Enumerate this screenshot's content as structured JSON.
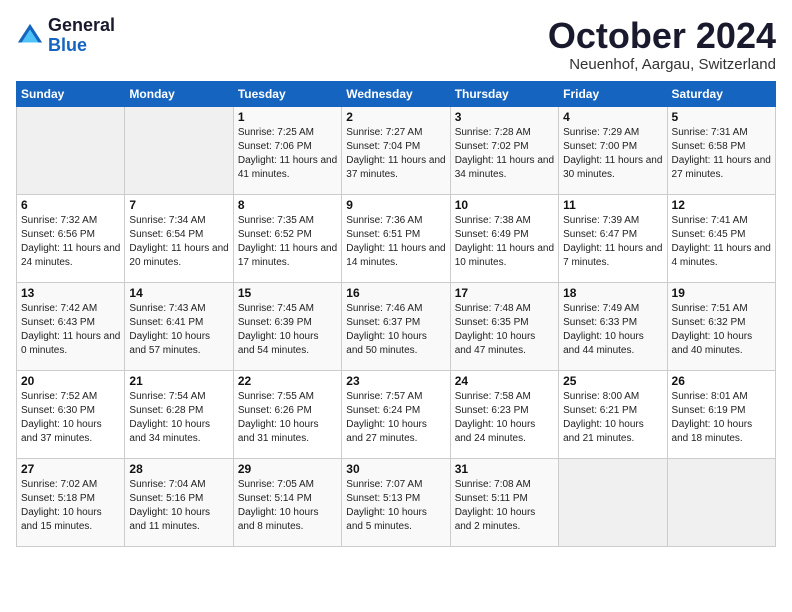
{
  "header": {
    "logo_general": "General",
    "logo_blue": "Blue",
    "month_title": "October 2024",
    "location": "Neuenhof, Aargau, Switzerland"
  },
  "days_of_week": [
    "Sunday",
    "Monday",
    "Tuesday",
    "Wednesday",
    "Thursday",
    "Friday",
    "Saturday"
  ],
  "weeks": [
    [
      {
        "day": "",
        "sunrise": "",
        "sunset": "",
        "daylight": ""
      },
      {
        "day": "",
        "sunrise": "",
        "sunset": "",
        "daylight": ""
      },
      {
        "day": "1",
        "sunrise": "Sunrise: 7:25 AM",
        "sunset": "Sunset: 7:06 PM",
        "daylight": "Daylight: 11 hours and 41 minutes."
      },
      {
        "day": "2",
        "sunrise": "Sunrise: 7:27 AM",
        "sunset": "Sunset: 7:04 PM",
        "daylight": "Daylight: 11 hours and 37 minutes."
      },
      {
        "day": "3",
        "sunrise": "Sunrise: 7:28 AM",
        "sunset": "Sunset: 7:02 PM",
        "daylight": "Daylight: 11 hours and 34 minutes."
      },
      {
        "day": "4",
        "sunrise": "Sunrise: 7:29 AM",
        "sunset": "Sunset: 7:00 PM",
        "daylight": "Daylight: 11 hours and 30 minutes."
      },
      {
        "day": "5",
        "sunrise": "Sunrise: 7:31 AM",
        "sunset": "Sunset: 6:58 PM",
        "daylight": "Daylight: 11 hours and 27 minutes."
      }
    ],
    [
      {
        "day": "6",
        "sunrise": "Sunrise: 7:32 AM",
        "sunset": "Sunset: 6:56 PM",
        "daylight": "Daylight: 11 hours and 24 minutes."
      },
      {
        "day": "7",
        "sunrise": "Sunrise: 7:34 AM",
        "sunset": "Sunset: 6:54 PM",
        "daylight": "Daylight: 11 hours and 20 minutes."
      },
      {
        "day": "8",
        "sunrise": "Sunrise: 7:35 AM",
        "sunset": "Sunset: 6:52 PM",
        "daylight": "Daylight: 11 hours and 17 minutes."
      },
      {
        "day": "9",
        "sunrise": "Sunrise: 7:36 AM",
        "sunset": "Sunset: 6:51 PM",
        "daylight": "Daylight: 11 hours and 14 minutes."
      },
      {
        "day": "10",
        "sunrise": "Sunrise: 7:38 AM",
        "sunset": "Sunset: 6:49 PM",
        "daylight": "Daylight: 11 hours and 10 minutes."
      },
      {
        "day": "11",
        "sunrise": "Sunrise: 7:39 AM",
        "sunset": "Sunset: 6:47 PM",
        "daylight": "Daylight: 11 hours and 7 minutes."
      },
      {
        "day": "12",
        "sunrise": "Sunrise: 7:41 AM",
        "sunset": "Sunset: 6:45 PM",
        "daylight": "Daylight: 11 hours and 4 minutes."
      }
    ],
    [
      {
        "day": "13",
        "sunrise": "Sunrise: 7:42 AM",
        "sunset": "Sunset: 6:43 PM",
        "daylight": "Daylight: 11 hours and 0 minutes."
      },
      {
        "day": "14",
        "sunrise": "Sunrise: 7:43 AM",
        "sunset": "Sunset: 6:41 PM",
        "daylight": "Daylight: 10 hours and 57 minutes."
      },
      {
        "day": "15",
        "sunrise": "Sunrise: 7:45 AM",
        "sunset": "Sunset: 6:39 PM",
        "daylight": "Daylight: 10 hours and 54 minutes."
      },
      {
        "day": "16",
        "sunrise": "Sunrise: 7:46 AM",
        "sunset": "Sunset: 6:37 PM",
        "daylight": "Daylight: 10 hours and 50 minutes."
      },
      {
        "day": "17",
        "sunrise": "Sunrise: 7:48 AM",
        "sunset": "Sunset: 6:35 PM",
        "daylight": "Daylight: 10 hours and 47 minutes."
      },
      {
        "day": "18",
        "sunrise": "Sunrise: 7:49 AM",
        "sunset": "Sunset: 6:33 PM",
        "daylight": "Daylight: 10 hours and 44 minutes."
      },
      {
        "day": "19",
        "sunrise": "Sunrise: 7:51 AM",
        "sunset": "Sunset: 6:32 PM",
        "daylight": "Daylight: 10 hours and 40 minutes."
      }
    ],
    [
      {
        "day": "20",
        "sunrise": "Sunrise: 7:52 AM",
        "sunset": "Sunset: 6:30 PM",
        "daylight": "Daylight: 10 hours and 37 minutes."
      },
      {
        "day": "21",
        "sunrise": "Sunrise: 7:54 AM",
        "sunset": "Sunset: 6:28 PM",
        "daylight": "Daylight: 10 hours and 34 minutes."
      },
      {
        "day": "22",
        "sunrise": "Sunrise: 7:55 AM",
        "sunset": "Sunset: 6:26 PM",
        "daylight": "Daylight: 10 hours and 31 minutes."
      },
      {
        "day": "23",
        "sunrise": "Sunrise: 7:57 AM",
        "sunset": "Sunset: 6:24 PM",
        "daylight": "Daylight: 10 hours and 27 minutes."
      },
      {
        "day": "24",
        "sunrise": "Sunrise: 7:58 AM",
        "sunset": "Sunset: 6:23 PM",
        "daylight": "Daylight: 10 hours and 24 minutes."
      },
      {
        "day": "25",
        "sunrise": "Sunrise: 8:00 AM",
        "sunset": "Sunset: 6:21 PM",
        "daylight": "Daylight: 10 hours and 21 minutes."
      },
      {
        "day": "26",
        "sunrise": "Sunrise: 8:01 AM",
        "sunset": "Sunset: 6:19 PM",
        "daylight": "Daylight: 10 hours and 18 minutes."
      }
    ],
    [
      {
        "day": "27",
        "sunrise": "Sunrise: 7:02 AM",
        "sunset": "Sunset: 5:18 PM",
        "daylight": "Daylight: 10 hours and 15 minutes."
      },
      {
        "day": "28",
        "sunrise": "Sunrise: 7:04 AM",
        "sunset": "Sunset: 5:16 PM",
        "daylight": "Daylight: 10 hours and 11 minutes."
      },
      {
        "day": "29",
        "sunrise": "Sunrise: 7:05 AM",
        "sunset": "Sunset: 5:14 PM",
        "daylight": "Daylight: 10 hours and 8 minutes."
      },
      {
        "day": "30",
        "sunrise": "Sunrise: 7:07 AM",
        "sunset": "Sunset: 5:13 PM",
        "daylight": "Daylight: 10 hours and 5 minutes."
      },
      {
        "day": "31",
        "sunrise": "Sunrise: 7:08 AM",
        "sunset": "Sunset: 5:11 PM",
        "daylight": "Daylight: 10 hours and 2 minutes."
      },
      {
        "day": "",
        "sunrise": "",
        "sunset": "",
        "daylight": ""
      },
      {
        "day": "",
        "sunrise": "",
        "sunset": "",
        "daylight": ""
      }
    ]
  ]
}
